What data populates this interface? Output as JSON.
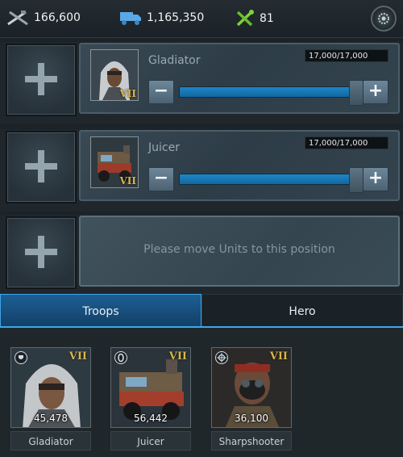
{
  "resources": [
    {
      "icon": "crossed-rifles-icon",
      "value": "166,600"
    },
    {
      "icon": "supply-truck-icon",
      "value": "1,165,350"
    },
    {
      "icon": "crossed-tools-icon",
      "value": "81"
    }
  ],
  "slots": [
    {
      "unit": "Gladiator",
      "rank": "VII",
      "count": "17,000/17,000",
      "level": 1.0,
      "minus": "−",
      "plus": "+"
    },
    {
      "unit": "Juicer",
      "rank": "VII",
      "count": "17,000/17,000",
      "level": 1.0,
      "minus": "−",
      "plus": "+"
    },
    {
      "empty_message": "Please move Units to this position"
    }
  ],
  "tabs": {
    "troops": "Troops",
    "hero": "Hero"
  },
  "troops": [
    {
      "name": "Gladiator",
      "count": "45,478",
      "rank": "VII",
      "type_icon": "shield-icon"
    },
    {
      "name": "Juicer",
      "count": "56,442",
      "rank": "VII",
      "type_icon": "tire-icon"
    },
    {
      "name": "Sharpshooter",
      "count": "36,100",
      "rank": "VII",
      "type_icon": "crosshair-icon"
    }
  ],
  "colors": {
    "accent": "#3da6f0",
    "rank": "#d9b64c",
    "slider_fill": "#1d86c5"
  }
}
